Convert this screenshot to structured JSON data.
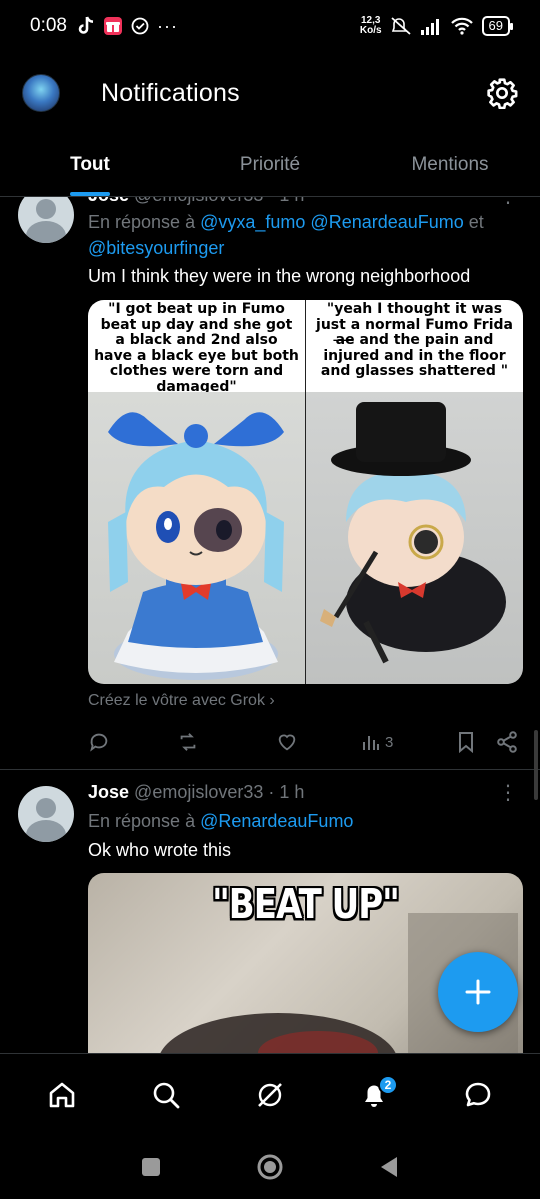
{
  "status_bar": {
    "time": "0:08",
    "net_speed_value": "12,3",
    "net_speed_unit": "Ko/s",
    "battery": "69"
  },
  "header": {
    "title": "Notifications"
  },
  "tabs": [
    {
      "label": "Tout",
      "active": true
    },
    {
      "label": "Priorité",
      "active": false
    },
    {
      "label": "Mentions",
      "active": false
    }
  ],
  "posts": [
    {
      "name": "Jose",
      "handle": "@emojislover33",
      "time": "· 1 h",
      "reply_prefix": "En réponse à",
      "mentions": [
        "@vyxa_fumo",
        "@RenardeauFumo",
        "@bitesyourfinger"
      ],
      "reply_conj": "et",
      "text": "Um I think they were in the wrong neighborhood",
      "image_caption_left": "\"I got beat up in Fumo beat up day and she got a black and 2nd also have a black eye but both clothes were torn and damaged\"",
      "image_caption_right": "\"yeah I thought it was just a normal Fumo Frida a̶e̶ and the pain and injured and in the floor and glasses shattered \"",
      "grok_label": "Créez le vôtre avec Grok",
      "views": "3"
    },
    {
      "name": "Jose",
      "handle": "@emojislover33",
      "time": "· 1 h",
      "reply_prefix": "En réponse à",
      "mentions": [
        "@RenardeauFumo"
      ],
      "text": "Ok who wrote this",
      "image_caption": "\"BEAT UP\""
    }
  ],
  "bottom_nav": {
    "notifications_badge": "2"
  },
  "colors": {
    "accent": "#1d9bf0",
    "background": "#000000",
    "muted": "#71767b"
  }
}
